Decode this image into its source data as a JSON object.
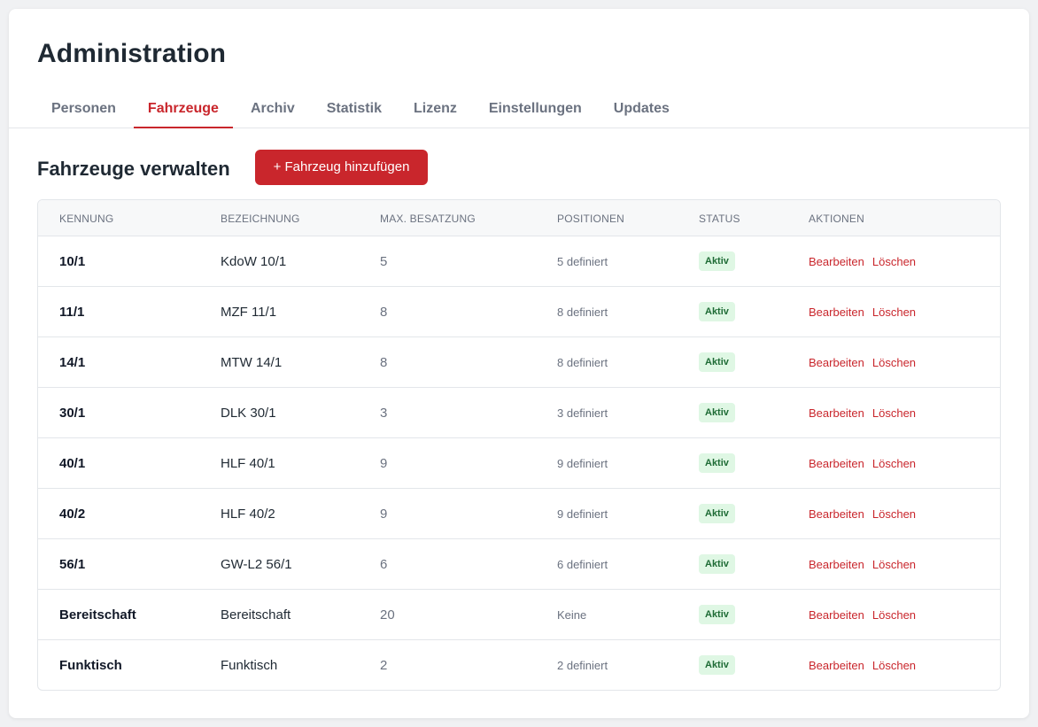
{
  "page": {
    "title": "Administration"
  },
  "tabs": [
    {
      "label": "Personen",
      "active": false
    },
    {
      "label": "Fahrzeuge",
      "active": true
    },
    {
      "label": "Archiv",
      "active": false
    },
    {
      "label": "Statistik",
      "active": false
    },
    {
      "label": "Lizenz",
      "active": false
    },
    {
      "label": "Einstellungen",
      "active": false
    },
    {
      "label": "Updates",
      "active": false
    }
  ],
  "section": {
    "title": "Fahrzeuge verwalten",
    "add_button_label": "+ Fahrzeug hinzufügen"
  },
  "table": {
    "headers": [
      "Kennung",
      "Bezeichnung",
      "Max. Besatzung",
      "Positionen",
      "Status",
      "Aktionen"
    ],
    "edit_label": "Bearbeiten",
    "delete_label": "Löschen",
    "rows": [
      {
        "kennung": "10/1",
        "bezeichnung": "KdoW 10/1",
        "max": "5",
        "positionen": "5 definiert",
        "status": "Aktiv"
      },
      {
        "kennung": "11/1",
        "bezeichnung": "MZF 11/1",
        "max": "8",
        "positionen": "8 definiert",
        "status": "Aktiv"
      },
      {
        "kennung": "14/1",
        "bezeichnung": "MTW 14/1",
        "max": "8",
        "positionen": "8 definiert",
        "status": "Aktiv"
      },
      {
        "kennung": "30/1",
        "bezeichnung": "DLK 30/1",
        "max": "3",
        "positionen": "3 definiert",
        "status": "Aktiv"
      },
      {
        "kennung": "40/1",
        "bezeichnung": "HLF 40/1",
        "max": "9",
        "positionen": "9 definiert",
        "status": "Aktiv"
      },
      {
        "kennung": "40/2",
        "bezeichnung": "HLF 40/2",
        "max": "9",
        "positionen": "9 definiert",
        "status": "Aktiv"
      },
      {
        "kennung": "56/1",
        "bezeichnung": "GW-L2 56/1",
        "max": "6",
        "positionen": "6 definiert",
        "status": "Aktiv"
      },
      {
        "kennung": "Bereitschaft",
        "bezeichnung": "Bereitschaft",
        "max": "20",
        "positionen": "Keine",
        "status": "Aktiv"
      },
      {
        "kennung": "Funktisch",
        "bezeichnung": "Funktisch",
        "max": "2",
        "positionen": "2 definiert",
        "status": "Aktiv"
      }
    ]
  },
  "colors": {
    "accent": "#c9262c",
    "status_bg": "#dff7e4",
    "status_text": "#1e6b35"
  }
}
